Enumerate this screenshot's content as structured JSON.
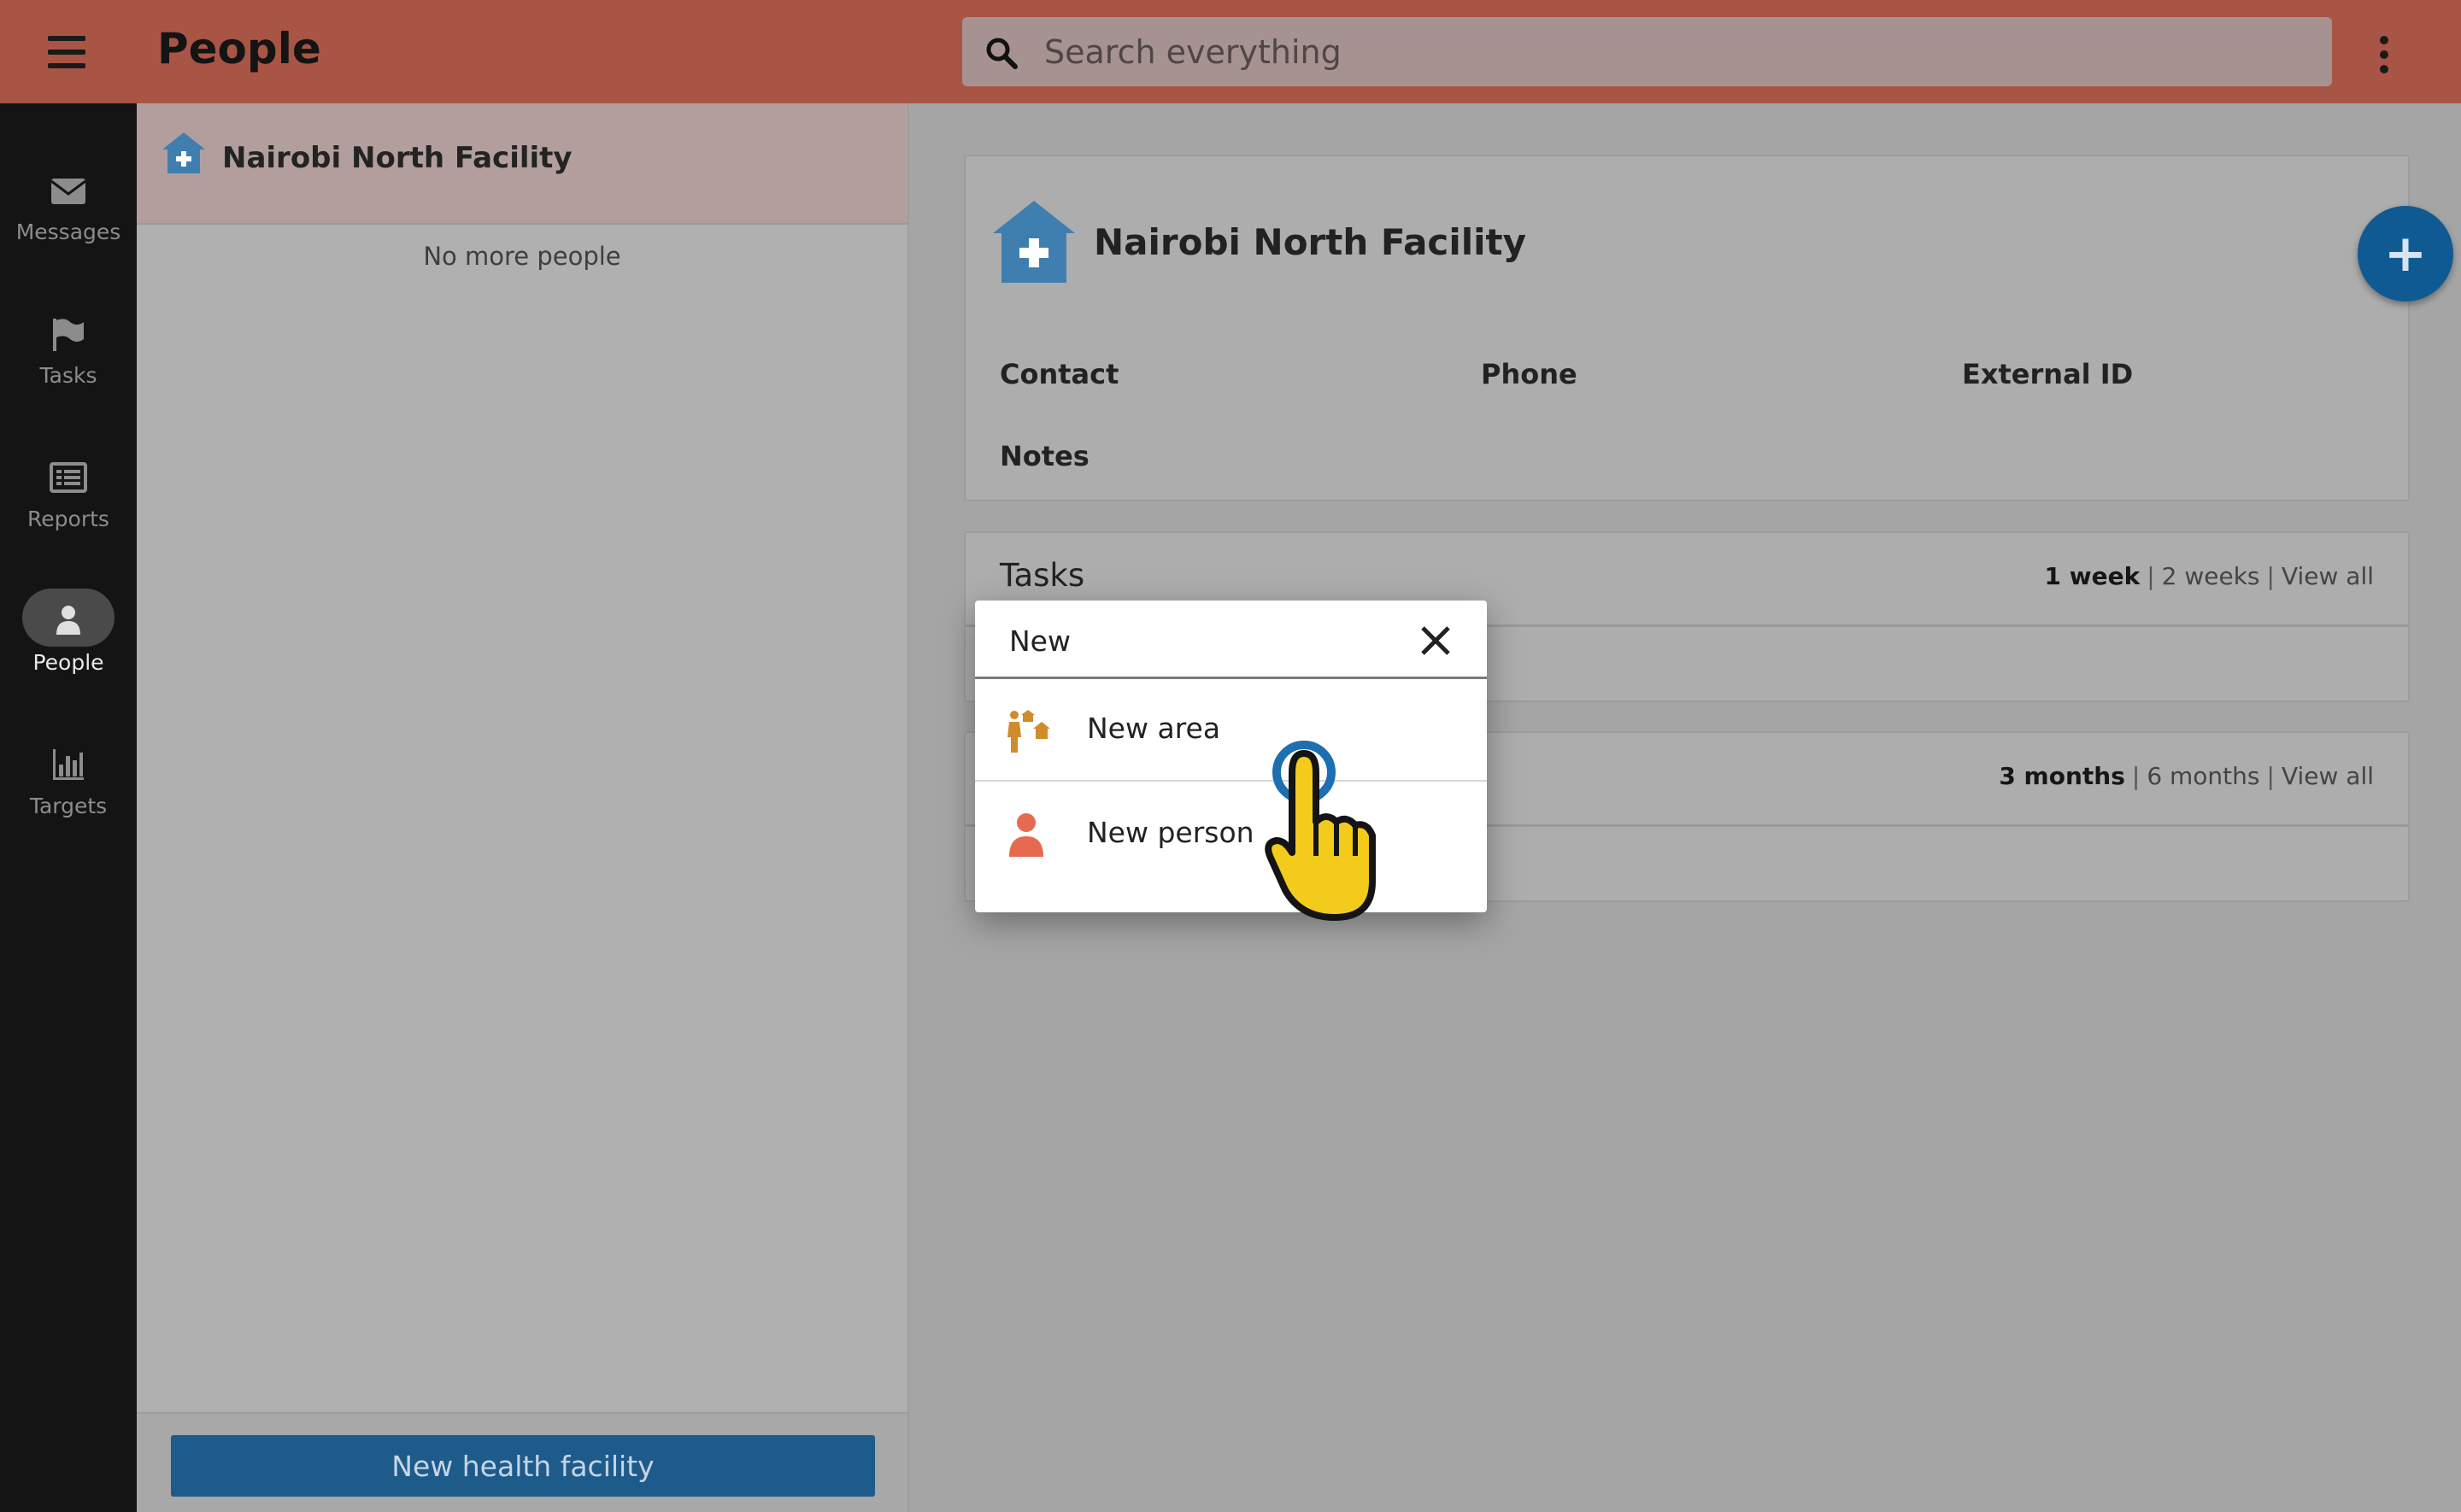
{
  "header": {
    "title": "People",
    "search_placeholder": "Search everything"
  },
  "nav": {
    "items": [
      {
        "label": "Messages",
        "icon": "envelope-icon"
      },
      {
        "label": "Tasks",
        "icon": "flag-icon"
      },
      {
        "label": "Reports",
        "icon": "list-icon"
      },
      {
        "label": "People",
        "icon": "person-icon",
        "active": true
      },
      {
        "label": "Targets",
        "icon": "bar-chart-icon"
      }
    ]
  },
  "list": {
    "selected_place": "Nairobi North Facility",
    "empty_text": "No more people",
    "new_button_label": "New health facility"
  },
  "detail": {
    "name": "Nairobi North Facility",
    "fields": {
      "contact": "Contact",
      "phone": "Phone",
      "external_id": "External ID",
      "notes": "Notes"
    },
    "tasks": {
      "title": "Tasks",
      "filters": [
        "1 week",
        "2 weeks",
        "View all"
      ]
    },
    "reports": {
      "filters": [
        "3 months",
        "6 months",
        "View all"
      ]
    },
    "fab_label": "+"
  },
  "dialog": {
    "title": "New",
    "options": [
      {
        "label": "New area",
        "icon": "area-icon"
      },
      {
        "label": "New person",
        "icon": "person-icon"
      }
    ]
  },
  "colors": {
    "header": "#a95546",
    "primary": "#1d5b8b",
    "facility_icon": "#3f7fb0",
    "area_icon": "#d08b2c",
    "person_icon": "#e66a50"
  }
}
